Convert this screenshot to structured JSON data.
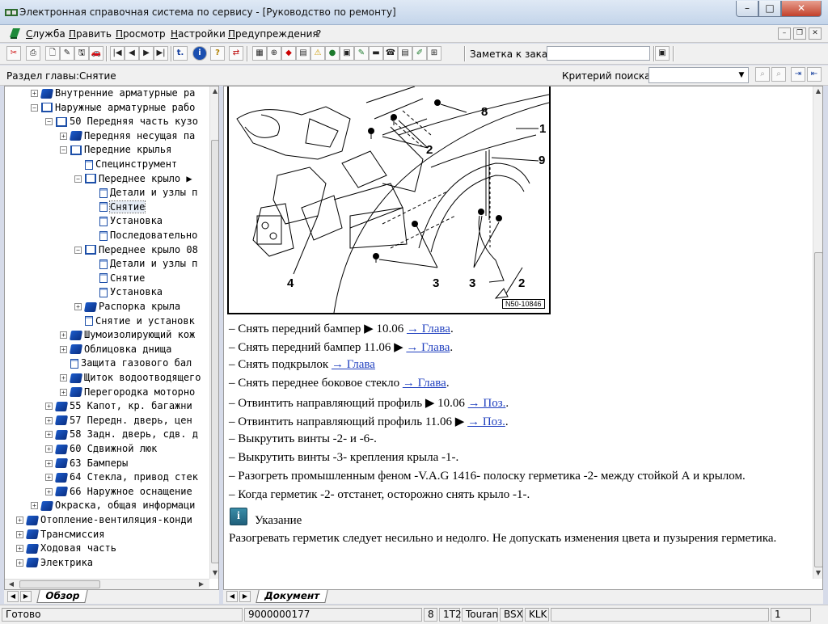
{
  "window": {
    "title": "Электронная справочная система по сервису - [Руководство по ремонту]",
    "controls": {
      "minimize": "–",
      "maximize": "□",
      "close": "✕"
    }
  },
  "menu": {
    "items": [
      "Служба",
      "Править",
      "Просмотр",
      "Настройки",
      "Предупреждения",
      "?"
    ],
    "mdi_controls": {
      "minimize": "–",
      "restore": "❐",
      "close": "✕"
    }
  },
  "toolbar": {
    "buttons": [
      "✂",
      "⎙",
      "🗋",
      "✎",
      "🖫",
      "🚗",
      "|◀",
      "◀",
      "▶",
      "▶|",
      "t.",
      "i",
      "?",
      "⇄",
      "▦",
      "⊕",
      "◆",
      "▤",
      "⚠",
      "●",
      "▣",
      "✎",
      "▬",
      "☎",
      "▤",
      "✐",
      "⊞"
    ],
    "note_label": "Заметка к заказу:",
    "note_value": "",
    "save_icon": "▣"
  },
  "search": {
    "section_label": "Раздел главы:Снятие",
    "criteria_label": "Критерий  поиска:",
    "criteria_value": "",
    "buttons": [
      "⌕",
      "⌕",
      "⇥",
      "⇤"
    ]
  },
  "tree": [
    {
      "label": "Внутренние арматурные ра",
      "indent": 1,
      "icon": "book",
      "exp": "+"
    },
    {
      "label": "Наружные арматурные рабо",
      "indent": 1,
      "icon": "openbook",
      "exp": "−"
    },
    {
      "label": "50 Передняя часть кузо",
      "indent": 2,
      "icon": "openbook",
      "exp": "−"
    },
    {
      "label": "Передняя несущая па",
      "indent": 3,
      "icon": "book",
      "exp": "+"
    },
    {
      "label": "Передние крылья",
      "indent": 3,
      "icon": "openbook",
      "exp": "−"
    },
    {
      "label": "Специнструмент",
      "indent": 4,
      "icon": "page",
      "exp": ""
    },
    {
      "label": "Переднее крыло ▶",
      "indent": 4,
      "icon": "openbook",
      "exp": "−"
    },
    {
      "label": "Детали и узлы п",
      "indent": 5,
      "icon": "page",
      "exp": ""
    },
    {
      "label": "Снятие",
      "indent": 5,
      "icon": "page",
      "exp": "",
      "selected": true
    },
    {
      "label": "Установка",
      "indent": 5,
      "icon": "page",
      "exp": ""
    },
    {
      "label": "Последовательно",
      "indent": 5,
      "icon": "page",
      "exp": ""
    },
    {
      "label": "Переднее крыло 08",
      "indent": 4,
      "icon": "openbook",
      "exp": "−"
    },
    {
      "label": "Детали и узлы п",
      "indent": 5,
      "icon": "page",
      "exp": ""
    },
    {
      "label": "Снятие",
      "indent": 5,
      "icon": "page",
      "exp": ""
    },
    {
      "label": "Установка",
      "indent": 5,
      "icon": "page",
      "exp": ""
    },
    {
      "label": "Распорка крыла",
      "indent": 4,
      "icon": "book",
      "exp": "+"
    },
    {
      "label": "Снятие и установк",
      "indent": 4,
      "icon": "page",
      "exp": ""
    },
    {
      "label": "Шумоизолирующий кож",
      "indent": 3,
      "icon": "book",
      "exp": "+"
    },
    {
      "label": "Облицовка днища",
      "indent": 3,
      "icon": "book",
      "exp": "+"
    },
    {
      "label": "Защита газового бал",
      "indent": 3,
      "icon": "page",
      "exp": ""
    },
    {
      "label": "Щиток водоотводящего",
      "indent": 3,
      "icon": "book",
      "exp": "+"
    },
    {
      "label": "Перегородка моторно",
      "indent": 3,
      "icon": "book",
      "exp": "+"
    },
    {
      "label": "55 Капот, кр. багажни",
      "indent": 2,
      "icon": "book",
      "exp": "+"
    },
    {
      "label": "57 Передн. дверь, цен",
      "indent": 2,
      "icon": "book",
      "exp": "+"
    },
    {
      "label": "58 Задн. дверь, сдв. д",
      "indent": 2,
      "icon": "book",
      "exp": "+"
    },
    {
      "label": "60 Сдвижной люк",
      "indent": 2,
      "icon": "book",
      "exp": "+"
    },
    {
      "label": "63 Бамперы",
      "indent": 2,
      "icon": "book",
      "exp": "+"
    },
    {
      "label": "64 Стекла, привод стек",
      "indent": 2,
      "icon": "book",
      "exp": "+"
    },
    {
      "label": "66 Наружное оснащение",
      "indent": 2,
      "icon": "book",
      "exp": "+"
    },
    {
      "label": "Окраска, общая информаци",
      "indent": 1,
      "icon": "book",
      "exp": "+"
    },
    {
      "label": "Отопление-вентиляция-конди",
      "indent": 0,
      "icon": "book",
      "exp": "+"
    },
    {
      "label": "Трансмиссия",
      "indent": 0,
      "icon": "book",
      "exp": "+"
    },
    {
      "label": "Ходовая часть",
      "indent": 0,
      "icon": "book",
      "exp": "+"
    },
    {
      "label": "Электрика",
      "indent": 0,
      "icon": "book",
      "exp": "+"
    }
  ],
  "left_tab": "Обзор",
  "right_tab": "Документ",
  "figure": {
    "id": "N50-10846",
    "callouts": [
      "1",
      "2",
      "3",
      "3",
      "2",
      "4",
      "8",
      "9",
      "2"
    ]
  },
  "steps": [
    {
      "text": "–  Снять передний бампер ▶ 10.06 ",
      "link": "→ Глава",
      "after": "."
    },
    {
      "text": "–  Снять передний бампер 11.06 ▶ ",
      "link": "→ Глава",
      "after": "."
    },
    {
      "text": "–  Снять подкрылок ",
      "link": "→ Глава",
      "after": ""
    },
    {
      "text": "–  Снять переднее боковое стекло ",
      "link": "→ Глава",
      "after": "."
    },
    {
      "text": "–  Отвинтить направляющий профиль ▶ 10.06 ",
      "link": "→ Поз.",
      "after": "."
    },
    {
      "text": "–  Отвинтить направляющий профиль 11.06 ▶ ",
      "link": "→ Поз.",
      "after": "."
    },
    {
      "text": "–  Выкрутить винты -2- и -6-.",
      "link": "",
      "after": ""
    },
    {
      "text": "–  Выкрутить винты -3- крепления крыла -1-.",
      "link": "",
      "after": ""
    },
    {
      "text": "–  Разогреть промышленным феном -V.A.G 1416- полоску герметика -2- между стойкой А и крылом.",
      "link": "",
      "after": ""
    },
    {
      "text": "–  Когда герметик -2- отстанет, осторожно снять крыло -1-.",
      "link": "",
      "after": ""
    }
  ],
  "note": {
    "icon": "i",
    "title": "Указание",
    "text": "Разогревать герметик следует несильно и недолго. Не допускать изменения цвета и пузырения герметика."
  },
  "status": {
    "state": "Готово",
    "code": "9000000177",
    "f1": "8",
    "f2": "1T2",
    "f3": "Touran",
    "f4": "BSX",
    "f5": "KLK",
    "f6": "",
    "f7": "1"
  }
}
